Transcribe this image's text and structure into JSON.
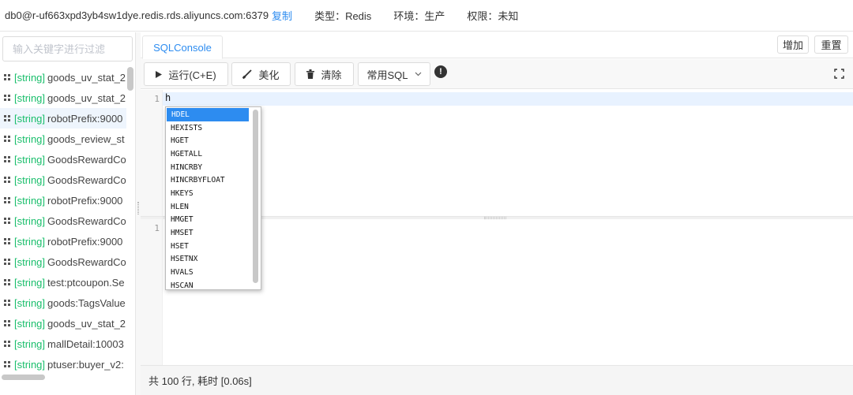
{
  "header": {
    "connection": "db0@r-uf663xpd3yb4sw1dye.redis.rds.aliyuncs.com:6379",
    "copy_label": "复制",
    "type_label": "类型：Redis",
    "env_label": "环境：生产",
    "perm_label": "权限：未知"
  },
  "sidebar": {
    "filter_placeholder": "输入关键字进行过滤",
    "items": [
      {
        "type": "[string]",
        "name": "goods_uv_stat_2"
      },
      {
        "type": "[string]",
        "name": "goods_uv_stat_2"
      },
      {
        "type": "[string]",
        "name": "robotPrefix:9000"
      },
      {
        "type": "[string]",
        "name": "goods_review_st"
      },
      {
        "type": "[string]",
        "name": "GoodsRewardCo"
      },
      {
        "type": "[string]",
        "name": "GoodsRewardCo"
      },
      {
        "type": "[string]",
        "name": "robotPrefix:9000"
      },
      {
        "type": "[string]",
        "name": "GoodsRewardCo"
      },
      {
        "type": "[string]",
        "name": "robotPrefix:9000"
      },
      {
        "type": "[string]",
        "name": "GoodsRewardCo"
      },
      {
        "type": "[string]",
        "name": "test:ptcoupon.Se"
      },
      {
        "type": "[string]",
        "name": "goods:TagsValue"
      },
      {
        "type": "[string]",
        "name": "goods_uv_stat_2"
      },
      {
        "type": "[string]",
        "name": "mallDetail:10003"
      },
      {
        "type": "[string]",
        "name": "ptuser:buyer_v2:"
      }
    ]
  },
  "tabs": {
    "active": "SQLConsole",
    "add_label": "增加",
    "reset_label": "重置"
  },
  "toolbar": {
    "run_label": "运行(C+E)",
    "beautify_label": "美化",
    "clear_label": "清除",
    "common_sql_label": "常用SQL",
    "info_glyph": "!"
  },
  "editor": {
    "line1_number": "1",
    "line1_text": "h",
    "result_line_number": "1"
  },
  "autocomplete": {
    "items": [
      "HDEL",
      "HEXISTS",
      "HGET",
      "HGETALL",
      "HINCRBY",
      "HINCRBYFLOAT",
      "HKEYS",
      "HLEN",
      "HMGET",
      "HMSET",
      "HSET",
      "HSETNX",
      "HVALS",
      "HSCAN"
    ],
    "selected": 0
  },
  "status": {
    "text": "共 100 行, 耗时 [0.06s]"
  },
  "colors": {
    "accent": "#2d8cf0",
    "string_type": "#19be6b"
  }
}
